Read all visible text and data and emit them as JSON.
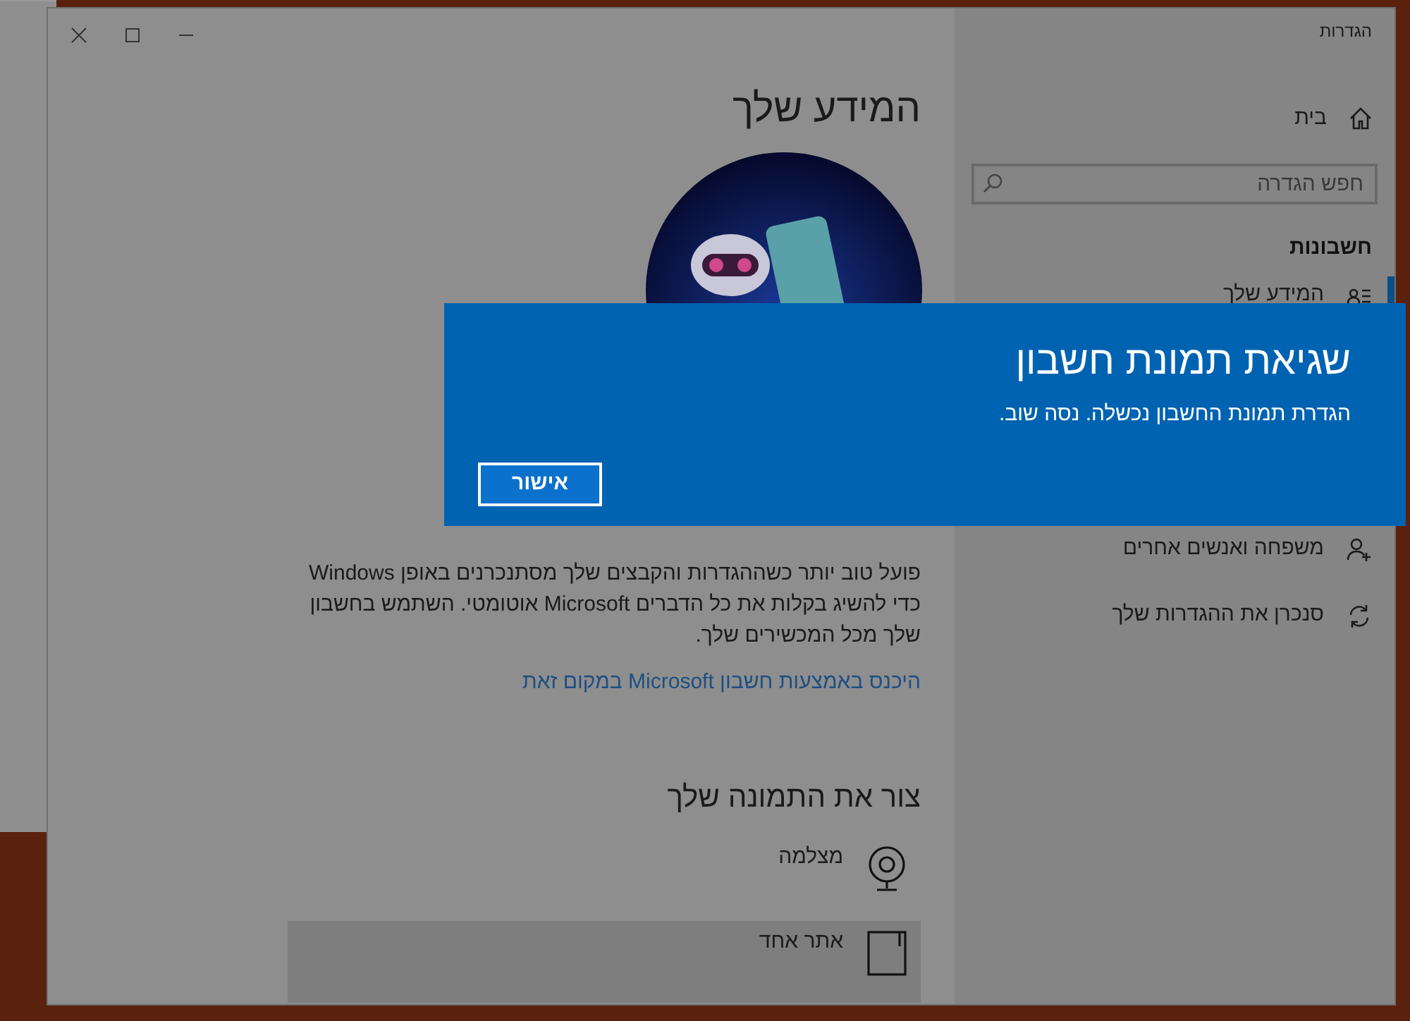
{
  "window": {
    "title": "הגדרות"
  },
  "sidebar": {
    "home": "בית",
    "search": {
      "placeholder": "חפש הגדרה"
    },
    "section": "חשבונות",
    "items": [
      {
        "label": "המידע שלך",
        "kind": "info",
        "selected": true
      }
    ],
    "more_items": [
      {
        "label": "משפחה ואנשים אחרים",
        "kind": "family",
        "selected": false
      },
      {
        "label": "סנכרן את ההגדרות שלך",
        "kind": "sync",
        "selected": false
      }
    ]
  },
  "page": {
    "title": "המידע שלך",
    "description": "פועל טוב יותר כשההגדרות והקבצים שלך מסתנכרנים באופן Windows כדי להשיג בקלות את כל הדברים Microsoft אוטומטי. השתמש בחשבון שלך מכל המכשירים שלך.",
    "link": "היכנס באמצעות חשבון Microsoft במקום זאת",
    "create_heading": "צור את התמונה שלך",
    "create_options": [
      {
        "label": "מצלמה",
        "kind": "camera",
        "selected": false
      },
      {
        "label": "אתר אחד",
        "kind": "browse",
        "selected": true
      }
    ]
  },
  "dialog": {
    "title": "שגיאת תמונת חשבון",
    "message": "הגדרת תמונת החשבון נכשלה. נסה שוב.",
    "button": "אישור"
  }
}
